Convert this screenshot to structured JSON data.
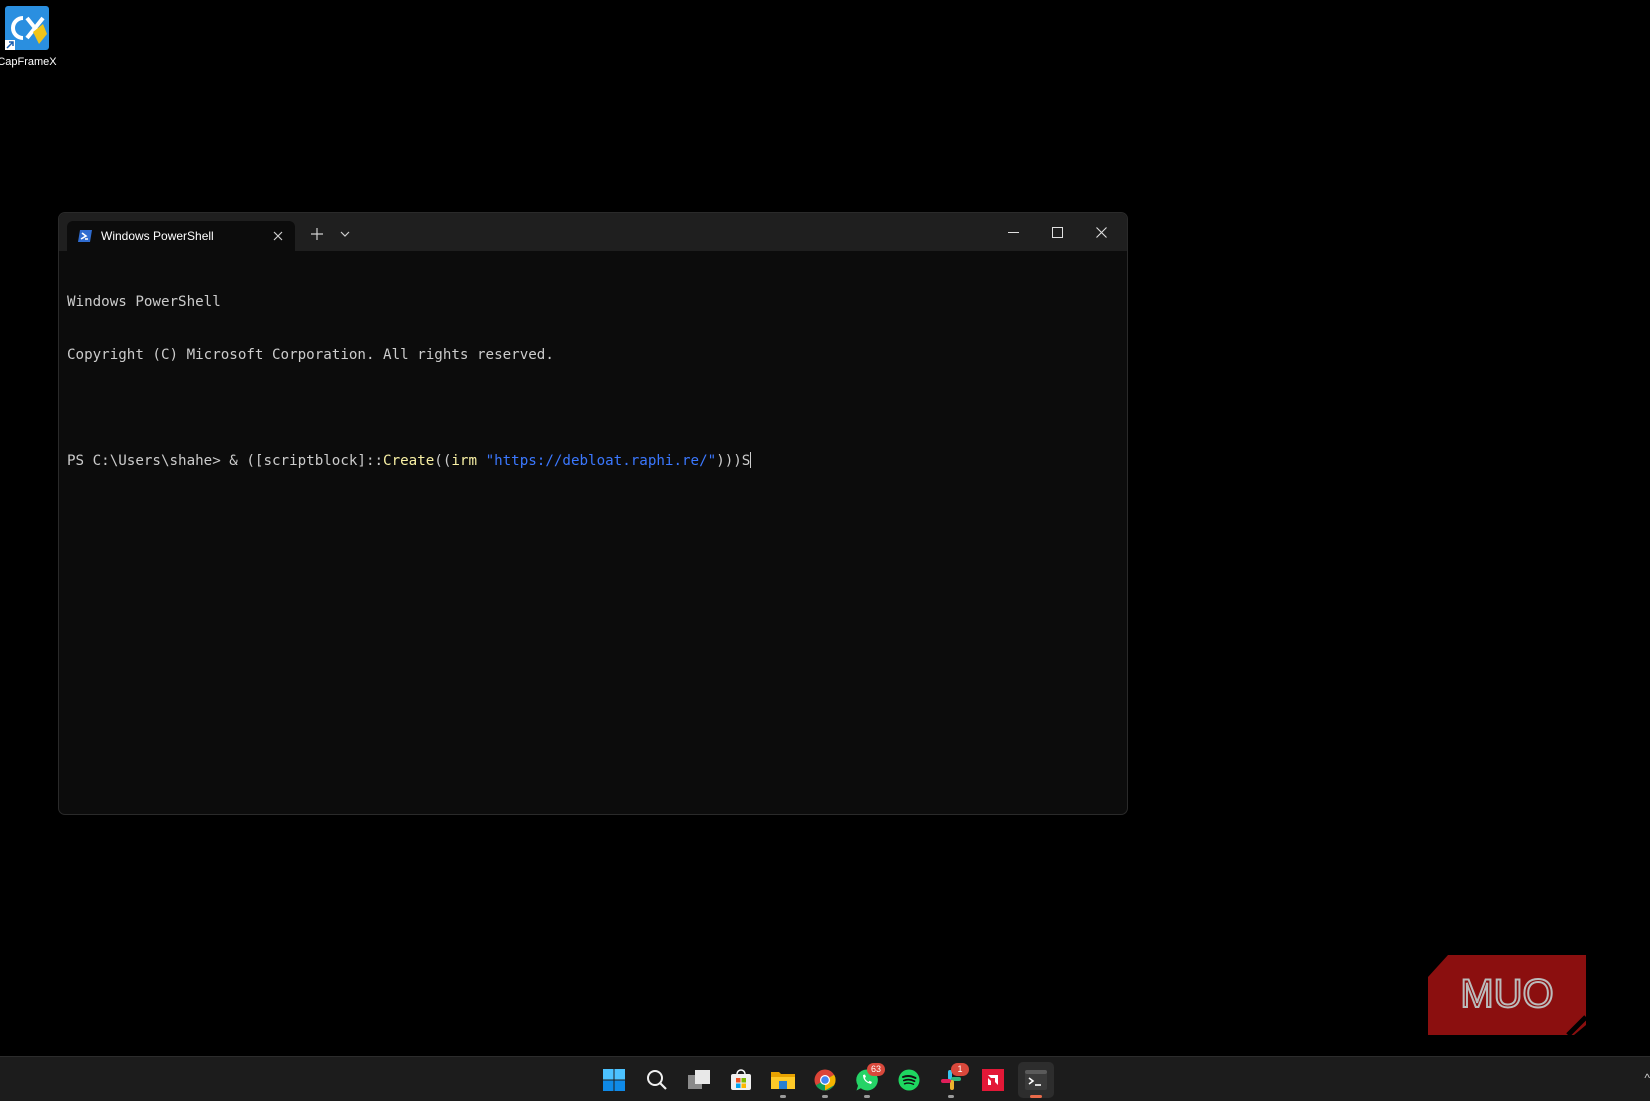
{
  "desktop": {
    "icon": {
      "label": "CapFrameX",
      "icon": "capframex-icon"
    }
  },
  "terminal": {
    "tab_title": "Windows PowerShell",
    "tab_icon": "powershell-icon",
    "lines": [
      "Windows PowerShell",
      "Copyright (C) Microsoft Corporation. All rights reserved.",
      ""
    ],
    "prompt": "PS C:\\Users\\shahe> ",
    "command": {
      "part1": "& ([scriptblock]::",
      "part2": "Create",
      "part3": "((",
      "part4": "irm",
      "part5": " ",
      "part6": "\"https://debloat.raphi.re/\"",
      "part7": ")))S"
    },
    "colors": {
      "background": "#0c0c0c",
      "text": "#cccccc",
      "cmdlet": "#f9f1a5",
      "string": "#3b78ff"
    }
  },
  "watermark": {
    "text": "MUO",
    "color": "#8b0f0f"
  },
  "taskbar": {
    "apps": [
      {
        "name": "start",
        "icon": "windows-start-icon"
      },
      {
        "name": "search",
        "icon": "search-icon"
      },
      {
        "name": "task-view",
        "icon": "task-view-icon"
      },
      {
        "name": "store",
        "icon": "microsoft-store-icon"
      },
      {
        "name": "file-explorer",
        "icon": "folder-icon"
      },
      {
        "name": "chrome",
        "icon": "chrome-icon"
      },
      {
        "name": "whatsapp",
        "icon": "whatsapp-icon",
        "badge": "63"
      },
      {
        "name": "spotify",
        "icon": "spotify-icon"
      },
      {
        "name": "slack",
        "icon": "slack-icon",
        "badge": "1"
      },
      {
        "name": "amd",
        "icon": "amd-icon"
      },
      {
        "name": "terminal",
        "icon": "terminal-icon",
        "active": true
      }
    ],
    "tray_chevron": "^"
  }
}
